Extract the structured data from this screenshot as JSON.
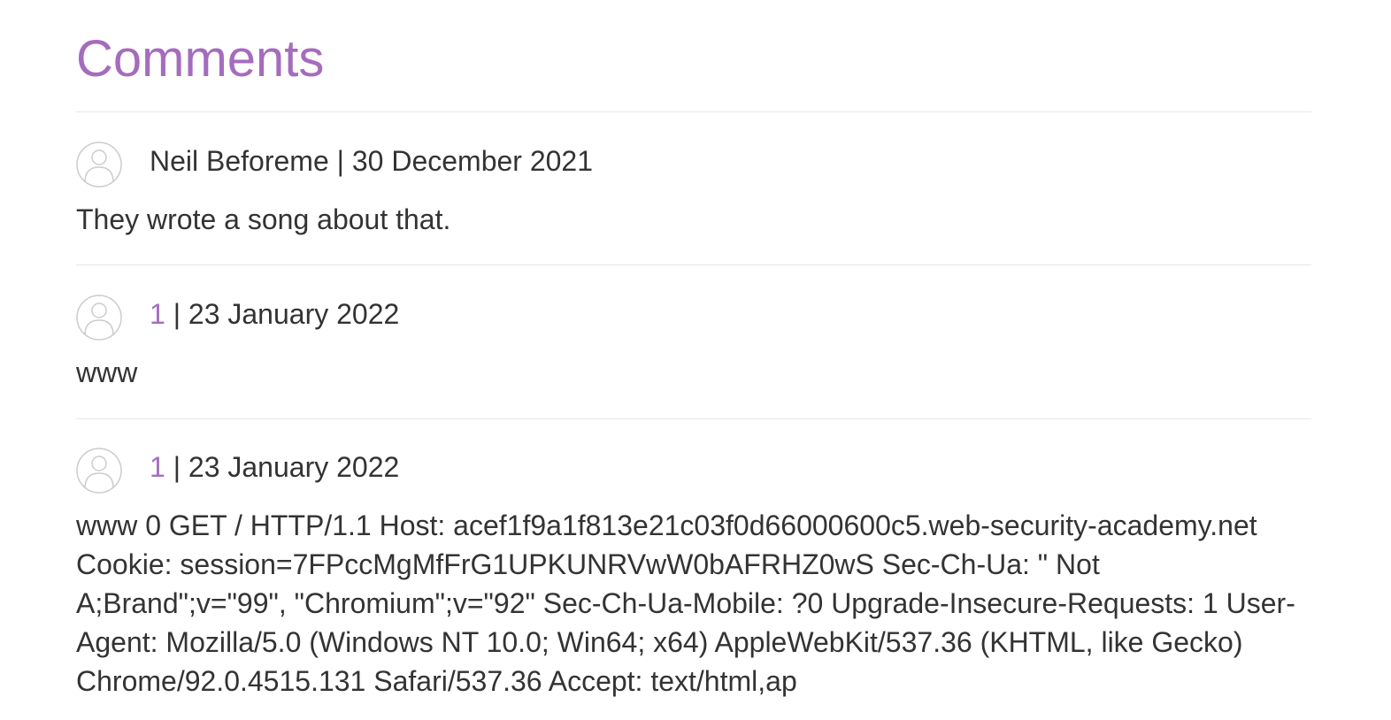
{
  "page": {
    "title": "Comments"
  },
  "comments": [
    {
      "author": "Neil Beforeme",
      "author_is_link": false,
      "separator": " | ",
      "date": "30 December 2021",
      "body": "They wrote a song about that."
    },
    {
      "author": "1",
      "author_is_link": true,
      "separator": " | ",
      "date": "23 January 2022",
      "body": "www"
    },
    {
      "author": "1",
      "author_is_link": true,
      "separator": " | ",
      "date": "23 January 2022",
      "body": "www 0 GET / HTTP/1.1 Host: acef1f9a1f813e21c03f0d66000600c5.web-security-academy.net Cookie: session=7FPccMgMfFrG1UPKUNRVwW0bAFRHZ0wS Sec-Ch-Ua: \" Not A;Brand\";v=\"99\", \"Chromium\";v=\"92\" Sec-Ch-Ua-Mobile: ?0 Upgrade-Insecure-Requests: 1 User-Agent: Mozilla/5.0 (Windows NT 10.0; Win64; x64) AppleWebKit/537.36 (KHTML, like Gecko) Chrome/92.0.4515.131 Safari/537.36 Accept: text/html,ap"
    }
  ],
  "icons": {
    "avatar": "user-avatar-icon"
  },
  "colors": {
    "accent": "#a56cbe",
    "text": "#333333",
    "rule": "#e6e6e6",
    "avatar_stroke": "#cccccc"
  }
}
